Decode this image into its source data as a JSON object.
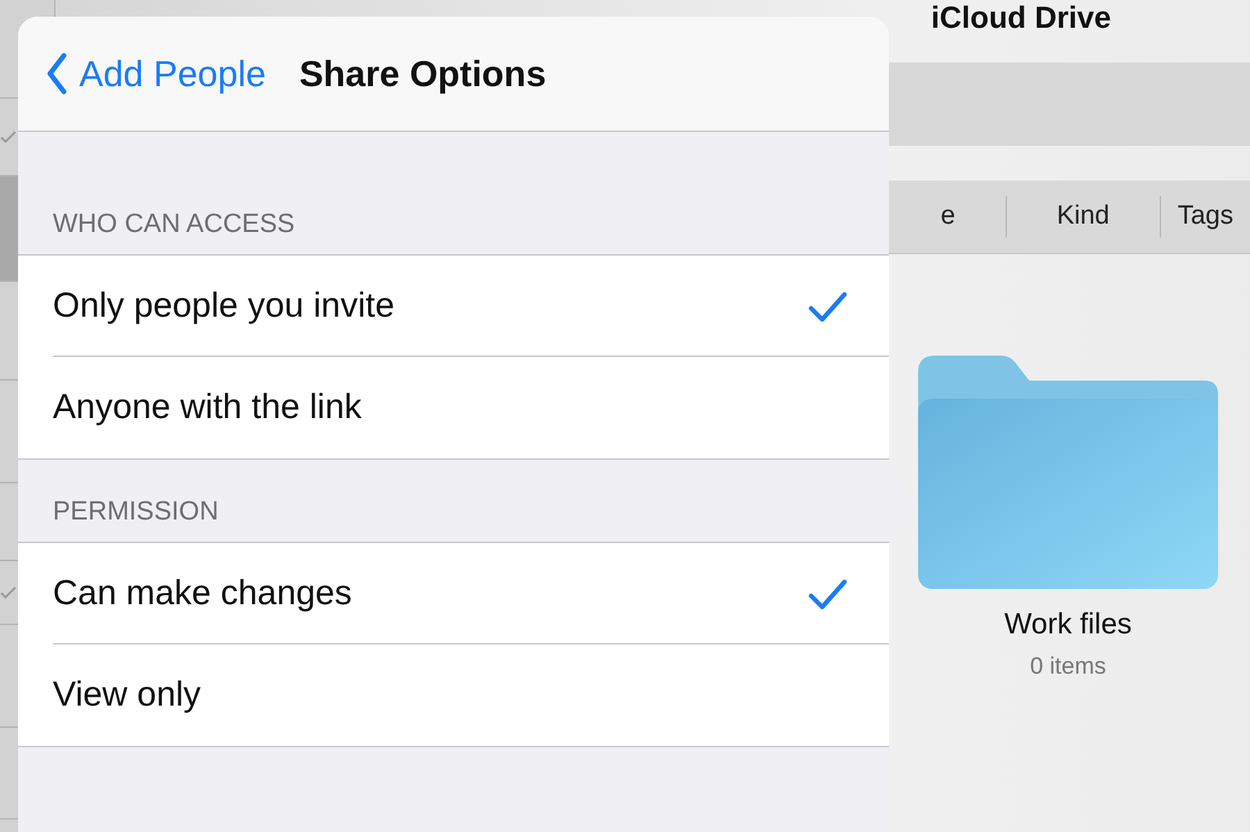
{
  "background": {
    "sidebar_rows": [
      {
        "selected": false,
        "checked": false
      },
      {
        "selected": false,
        "checked": true
      },
      {
        "selected": true,
        "checked": false
      },
      {
        "selected": false,
        "checked": false
      },
      {
        "selected": false,
        "checked": false
      },
      {
        "selected": false,
        "checked": false
      },
      {
        "selected": false,
        "checked": true
      },
      {
        "selected": false,
        "checked": false
      },
      {
        "selected": false,
        "checked": false
      }
    ],
    "title": "iCloud Drive",
    "columns": [
      "e",
      "Kind",
      "Tags"
    ],
    "folder": {
      "name": "Work files",
      "count": "0 items"
    }
  },
  "popover": {
    "back": "Add People",
    "title": "Share Options",
    "sections": [
      {
        "header": "WHO CAN ACCESS",
        "options": [
          {
            "label": "Only people you invite",
            "selected": true
          },
          {
            "label": "Anyone with the link",
            "selected": false
          }
        ]
      },
      {
        "header": "PERMISSION",
        "options": [
          {
            "label": "Can make changes",
            "selected": true
          },
          {
            "label": "View only",
            "selected": false
          }
        ]
      }
    ]
  }
}
